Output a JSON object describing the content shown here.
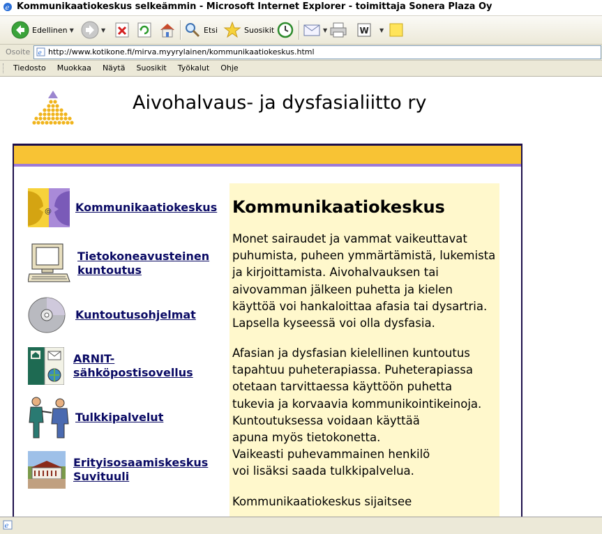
{
  "window": {
    "title": "Kommunikaatiokeskus selkeämmin - Microsoft Internet Explorer - toimittaja Sonera Plaza Oy"
  },
  "toolbar": {
    "back_label": "Edellinen",
    "search_label": "Etsi",
    "favorites_label": "Suosikit"
  },
  "address": {
    "label": "Osoite",
    "url": "http://www.kotikone.fi/mirva.myyrylainen/kommunikaatiokeskus.html"
  },
  "menu": [
    "Tiedosto",
    "Muokkaa",
    "Näytä",
    "Suosikit",
    "Työkalut",
    "Ohje"
  ],
  "page": {
    "site_title": "Aivohalvaus- ja dysfasialiitto ry",
    "nav": [
      {
        "line1": "Kommunikaatiokeskus",
        "line2": ""
      },
      {
        "line1": "Tietokoneavusteinen",
        "line2": "kuntoutus"
      },
      {
        "line1": "Kuntoutusohjelmat",
        "line2": ""
      },
      {
        "line1": "ARNIT-",
        "line2": "sähköpostisovellus"
      },
      {
        "line1": "Tulkkipalvelut",
        "line2": ""
      },
      {
        "line1": "Erityisosaamiskeskus",
        "line2": "Suvituuli"
      }
    ],
    "content": {
      "heading": "Kommunikaatiokeskus",
      "p1": "Monet sairaudet ja vammat vaikeuttavat\npuhumista, puheen ymmärtämistä, lukemista\nja kirjoittamista. Aivohalvauksen tai\naivovamman jälkeen puhetta ja kielen\nkäyttöä voi hankaloittaa afasia tai dysartria.\nLapsella kyseessä voi olla dysfasia.",
      "p2": "Afasian ja dysfasian kielellinen kuntoutus\ntapahtuu puheterapiassa. Puheterapiassa\notetaan tarvittaessa käyttöön puhetta\ntukevia ja korvaavia kommunikointikeinoja.\nKuntoutuksessa voidaan käyttää\napuna myös tietokonetta.\nVaikeasti puhevammainen henkilö\nvoi lisäksi saada tulkkipalvelua.",
      "p3": "Kommunikaatiokeskus sijaitsee"
    }
  },
  "colors": {
    "band_yellow": "#f8c334",
    "band_purple": "#9d7bd6",
    "frame": "#1c0e4a",
    "content_bg": "#fff8cc",
    "link": "#0a0a64"
  }
}
